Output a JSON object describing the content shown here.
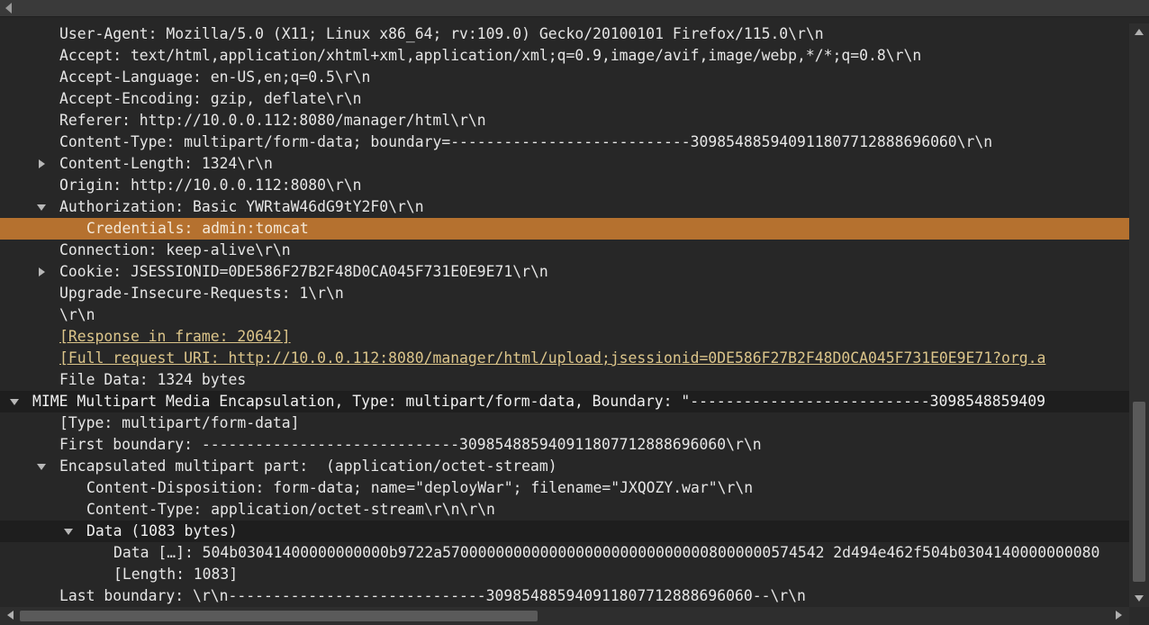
{
  "tree": {
    "rows": [
      {
        "text": "User-Agent: Mozilla/5.0 (X11; Linux x86_64; rv:109.0) Gecko/20100101 Firefox/115.0\\r\\n"
      },
      {
        "text": "Accept: text/html,application/xhtml+xml,application/xml;q=0.9,image/avif,image/webp,*/*;q=0.8\\r\\n"
      },
      {
        "text": "Accept-Language: en-US,en;q=0.5\\r\\n"
      },
      {
        "text": "Accept-Encoding: gzip, deflate\\r\\n"
      },
      {
        "text": "Referer: http://10.0.0.112:8080/manager/html\\r\\n"
      },
      {
        "text": "Content-Type: multipart/form-data; boundary=---------------------------309854885940911807712888696060\\r\\n"
      },
      {
        "text": "Content-Length: 1324\\r\\n"
      },
      {
        "text": "Origin: http://10.0.0.112:8080\\r\\n"
      },
      {
        "text": "Authorization: Basic YWRtaW46dG9tY2F0\\r\\n"
      },
      {
        "text": "Credentials: admin:tomcat"
      },
      {
        "text": "Connection: keep-alive\\r\\n"
      },
      {
        "text": "Cookie: JSESSIONID=0DE586F27B2F48D0CA045F731E0E9E71\\r\\n"
      },
      {
        "text": "Upgrade-Insecure-Requests: 1\\r\\n"
      },
      {
        "text": "\\r\\n"
      },
      {
        "text": "[Response in frame: 20642]"
      },
      {
        "text": "[Full request URI: http://10.0.0.112:8080/manager/html/upload;jsessionid=0DE586F27B2F48D0CA045F731E0E9E71?org.a"
      },
      {
        "text": "File Data: 1324 bytes"
      },
      {
        "text": "MIME Multipart Media Encapsulation, Type: multipart/form-data, Boundary: \"---------------------------3098548859409"
      },
      {
        "text": "[Type: multipart/form-data]"
      },
      {
        "text": "First boundary: -----------------------------309854885940911807712888696060\\r\\n"
      },
      {
        "text": "Encapsulated multipart part:  (application/octet-stream)"
      },
      {
        "text": "Content-Disposition: form-data; name=\"deployWar\"; filename=\"JXQOZY.war\"\\r\\n"
      },
      {
        "text": "Content-Type: application/octet-stream\\r\\n\\r\\n"
      },
      {
        "text": "Data (1083 bytes)"
      },
      {
        "text": "Data […]: 504b03041400000000000b9722a5700000000000000000000000000008000000574542 2d494e462f504b0304140000000080"
      },
      {
        "text": "[Length: 1083]"
      },
      {
        "text": "Last boundary: \\r\\n-----------------------------309854885940911807712888696060--\\r\\n"
      }
    ]
  },
  "colors": {
    "background": "#272727",
    "selected_row": "#b5712f",
    "link_text": "#dcc58a"
  }
}
